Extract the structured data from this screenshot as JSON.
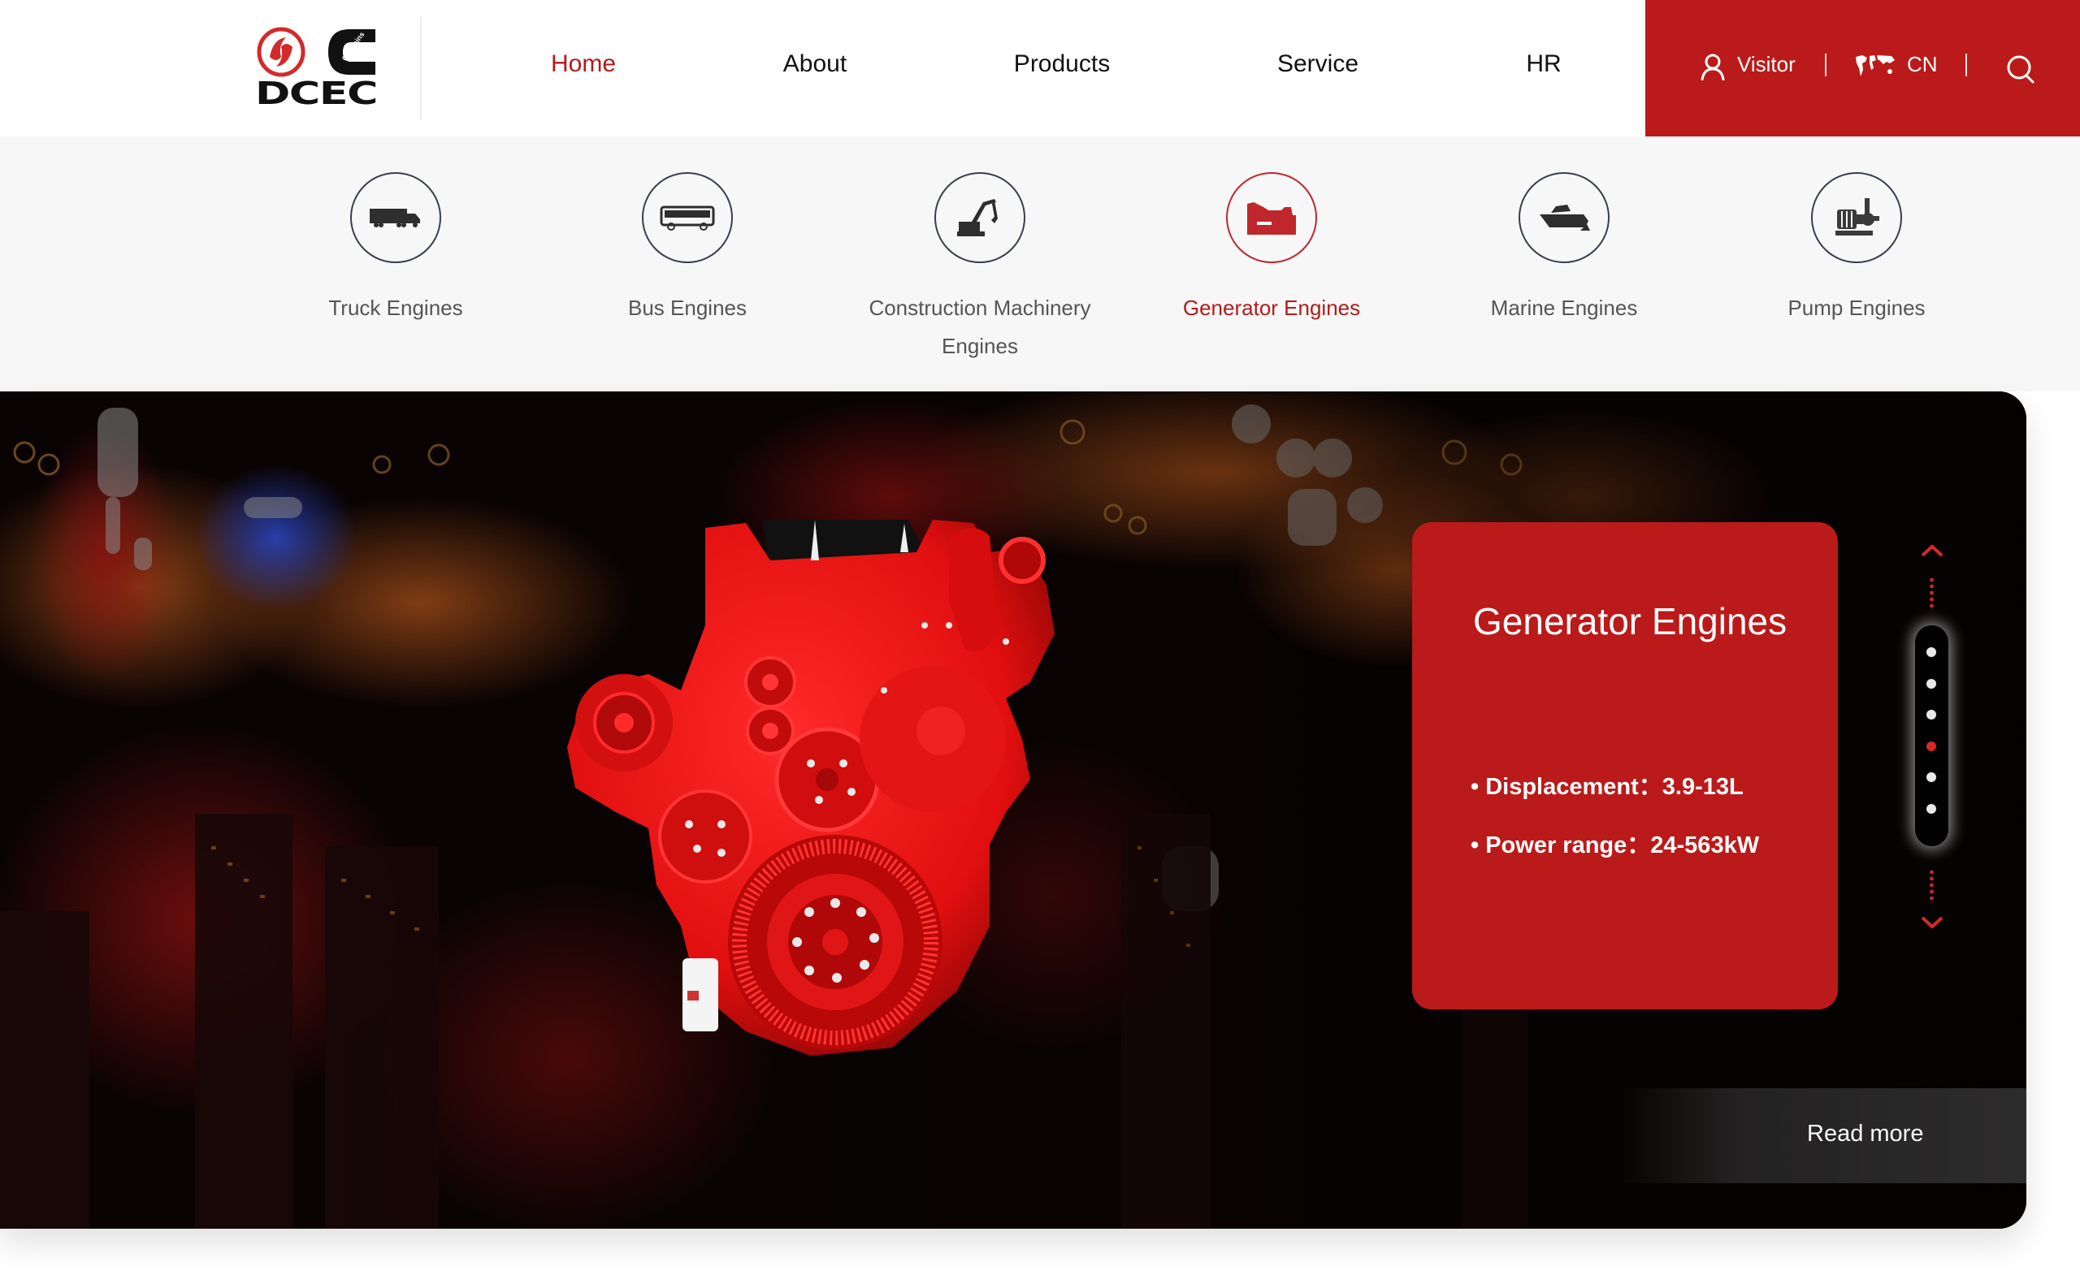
{
  "header": {
    "logo": {
      "brand_text": "DCEC",
      "sub_brand": "Cummins"
    },
    "nav": [
      {
        "label": "Home",
        "active": true
      },
      {
        "label": "About",
        "active": false
      },
      {
        "label": "Products",
        "active": false
      },
      {
        "label": "Service",
        "active": false
      },
      {
        "label": "HR",
        "active": false
      }
    ],
    "utility": {
      "user_label": "Visitor",
      "user_icon": "user-icon",
      "language_label": "CN",
      "language_icon": "world-map-icon",
      "search_icon": "search-icon"
    }
  },
  "categories": [
    {
      "label": "Truck Engines",
      "icon": "truck-icon",
      "active": false
    },
    {
      "label": "Bus Engines",
      "icon": "bus-icon",
      "active": false
    },
    {
      "label": "Construction Machinery Engines",
      "icon": "excavator-icon",
      "active": false
    },
    {
      "label": "Generator Engines",
      "icon": "generator-icon",
      "active": true
    },
    {
      "label": "Marine Engines",
      "icon": "boat-icon",
      "active": false
    },
    {
      "label": "Pump Engines",
      "icon": "pump-icon",
      "active": false
    }
  ],
  "hero": {
    "title": "Generator Engines",
    "specs": [
      {
        "label": "Displacement",
        "value": "3.9-13L",
        "text": "• Displacement：3.9-13L"
      },
      {
        "label": "Power range",
        "value": "24-563kW",
        "text": "• Power range：24-563kW"
      }
    ],
    "read_more_label": "Read more",
    "pager": {
      "total": 6,
      "active_index": 3
    }
  },
  "colors": {
    "brand_red": "#bb1a1a",
    "active_text_red": "#b31b1b",
    "icon_stroke": "#3a3f4c",
    "category_bg": "#f7f7f8"
  }
}
